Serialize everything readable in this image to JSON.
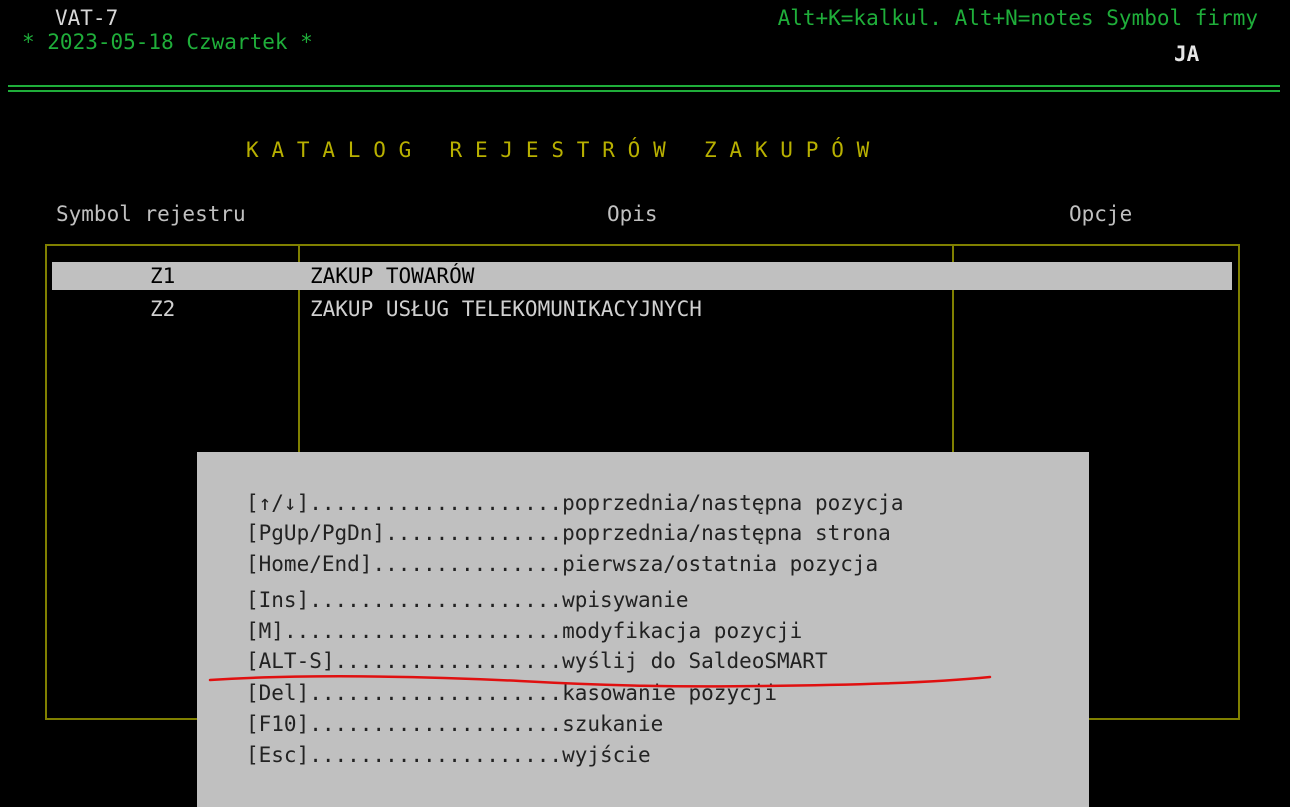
{
  "header": {
    "app_name": "VAT-7",
    "hotkeys": "Alt+K=kalkul. Alt+N=notes Symbol firmy",
    "date_line": "* 2023-05-18 Czwartek *",
    "company_symbol": "JA"
  },
  "screen_title": "KATALOG REJESTRÓW ZAKUPÓW",
  "table": {
    "columns": [
      "Symbol rejestru",
      "Opis",
      "Opcje"
    ],
    "rows": [
      {
        "symbol": "Z1",
        "description": "ZAKUP TOWARÓW",
        "options": "",
        "selected": true
      },
      {
        "symbol": "Z2",
        "description": "ZAKUP USŁUG TELEKOMUNIKACYJNYCH",
        "options": "",
        "selected": false
      }
    ]
  },
  "help": {
    "items": [
      {
        "key": "[↑/↓]",
        "dots": "....................",
        "action": "poprzednia/następna pozycja"
      },
      {
        "key": "[PgUp/PgDn]",
        "dots": "..............",
        "action": "poprzednia/następna strona"
      },
      {
        "key": "[Home/End]",
        "dots": "...............",
        "action": "pierwsza/ostatnia pozycja"
      },
      {
        "key": "[Ins]",
        "dots": "....................",
        "action": "wpisywanie"
      },
      {
        "key": "[M]",
        "dots": "......................",
        "action": "modyfikacja pozycji"
      },
      {
        "key": "[ALT-S]",
        "dots": "..................",
        "action": "wyślij do SaldeoSMART"
      },
      {
        "key": "[Del]",
        "dots": "....................",
        "action": "kasowanie pozycji"
      },
      {
        "key": "[F10]",
        "dots": "....................",
        "action": "szukanie"
      },
      {
        "key": "[Esc]",
        "dots": "....................",
        "action": "wyjście"
      }
    ]
  },
  "colors": {
    "terminal_green": "#1fae3a",
    "title_yellow": "#b8b000",
    "frame_olive": "#808000",
    "highlight_gray": "#c0c0c0",
    "annotation_red": "#e01010"
  }
}
